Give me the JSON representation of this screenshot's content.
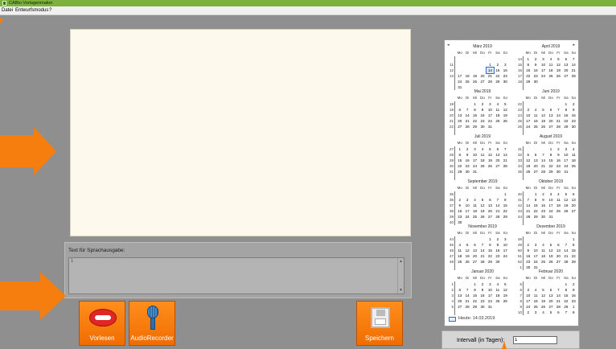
{
  "window": {
    "title": "CABto Vorlagenmaker"
  },
  "menu": [
    "Datei",
    "Entwurfsmodus",
    "?"
  ],
  "speech": {
    "label": "Text für Sprachausgabe:",
    "value": "1"
  },
  "buttons": {
    "speak": "Vorlesen",
    "recorder": "AudioRecorder",
    "save": "Speichern"
  },
  "calendar": {
    "nav_prev": "◂",
    "nav_next": "▸",
    "day_headers": [
      "Mo",
      "Di",
      "Mi",
      "Do",
      "Fr",
      "Sa",
      "So"
    ],
    "today_label": "Heute: 14.03.2019",
    "months": [
      {
        "title": "März 2019",
        "weeks": [
          "",
          "11",
          "12",
          "13",
          "",
          ""
        ],
        "days": [
          "",
          "",
          "",
          "",
          "",
          "",
          "",
          "",
          "",
          "",
          "",
          "1",
          "2",
          "3",
          "",
          "",
          "",
          "",
          "14",
          "15",
          "16",
          "17",
          "18",
          "19",
          "20",
          "21",
          "22",
          "23",
          "24",
          "25",
          "26",
          "27",
          "28",
          "29",
          "30",
          "31"
        ],
        "dim": [],
        "today": "14"
      },
      {
        "title": "April 2019",
        "weeks": [
          "14",
          "15",
          "16",
          "17",
          "18",
          ""
        ],
        "days": [
          "1",
          "2",
          "3",
          "4",
          "5",
          "6",
          "7",
          "8",
          "9",
          "10",
          "11",
          "12",
          "13",
          "14",
          "15",
          "16",
          "17",
          "18",
          "19",
          "20",
          "21",
          "22",
          "23",
          "24",
          "25",
          "26",
          "27",
          "28",
          "29",
          "30"
        ]
      },
      {
        "title": "Mai 2019",
        "weeks": [
          "18",
          "19",
          "20",
          "21",
          "22",
          ""
        ],
        "days": [
          "",
          "",
          "1",
          "2",
          "3",
          "4",
          "5",
          "6",
          "7",
          "8",
          "9",
          "10",
          "11",
          "12",
          "13",
          "14",
          "15",
          "16",
          "17",
          "18",
          "19",
          "20",
          "21",
          "22",
          "23",
          "24",
          "25",
          "26",
          "27",
          "28",
          "29",
          "30",
          "31"
        ]
      },
      {
        "title": "Juni 2019",
        "weeks": [
          "22",
          "23",
          "24",
          "25",
          "26",
          ""
        ],
        "days": [
          "",
          "",
          "",
          "",
          "",
          "1",
          "2",
          "3",
          "4",
          "5",
          "6",
          "7",
          "8",
          "9",
          "10",
          "11",
          "12",
          "13",
          "14",
          "15",
          "16",
          "17",
          "18",
          "19",
          "20",
          "21",
          "22",
          "23",
          "24",
          "25",
          "26",
          "27",
          "28",
          "29",
          "30"
        ]
      },
      {
        "title": "Juli 2019",
        "weeks": [
          "27",
          "28",
          "29",
          "30",
          "31",
          ""
        ],
        "days": [
          "1",
          "2",
          "3",
          "4",
          "5",
          "6",
          "7",
          "8",
          "9",
          "10",
          "11",
          "12",
          "13",
          "14",
          "15",
          "16",
          "17",
          "18",
          "19",
          "20",
          "21",
          "22",
          "23",
          "24",
          "25",
          "26",
          "27",
          "28",
          "29",
          "30",
          "31"
        ]
      },
      {
        "title": "August 2019",
        "weeks": [
          "31",
          "32",
          "33",
          "34",
          "35",
          ""
        ],
        "days": [
          "",
          "",
          "",
          "1",
          "2",
          "3",
          "4",
          "5",
          "6",
          "7",
          "8",
          "9",
          "10",
          "11",
          "12",
          "13",
          "14",
          "15",
          "16",
          "17",
          "18",
          "19",
          "20",
          "21",
          "22",
          "23",
          "24",
          "25",
          "26",
          "27",
          "28",
          "29",
          "30",
          "31"
        ]
      },
      {
        "title": "September 2019",
        "weeks": [
          "35",
          "36",
          "37",
          "38",
          "39",
          "40"
        ],
        "days": [
          "",
          "",
          "",
          "",
          "",
          "",
          "1",
          "2",
          "3",
          "4",
          "5",
          "6",
          "7",
          "8",
          "9",
          "10",
          "11",
          "12",
          "13",
          "14",
          "15",
          "16",
          "17",
          "18",
          "19",
          "20",
          "21",
          "22",
          "23",
          "24",
          "25",
          "26",
          "27",
          "28",
          "29",
          "30"
        ]
      },
      {
        "title": "Oktober 2019",
        "weeks": [
          "40",
          "41",
          "42",
          "43",
          "44",
          ""
        ],
        "days": [
          "",
          "1",
          "2",
          "3",
          "4",
          "5",
          "6",
          "7",
          "8",
          "9",
          "10",
          "11",
          "12",
          "13",
          "14",
          "15",
          "16",
          "17",
          "18",
          "19",
          "20",
          "21",
          "22",
          "23",
          "24",
          "25",
          "26",
          "27",
          "28",
          "29",
          "30",
          "31"
        ]
      },
      {
        "title": "November 2019",
        "weeks": [
          "44",
          "45",
          "46",
          "47",
          "48",
          ""
        ],
        "days": [
          "",
          "",
          "",
          "",
          "1",
          "2",
          "3",
          "4",
          "5",
          "6",
          "7",
          "8",
          "9",
          "10",
          "11",
          "12",
          "13",
          "14",
          "15",
          "16",
          "17",
          "18",
          "19",
          "20",
          "21",
          "22",
          "23",
          "24",
          "25",
          "26",
          "27",
          "28",
          "29",
          "30"
        ]
      },
      {
        "title": "Dezember 2019",
        "weeks": [
          "48",
          "49",
          "50",
          "51",
          "52",
          "1"
        ],
        "days": [
          "",
          "",
          "",
          "",
          "",
          "",
          "1",
          "2",
          "3",
          "4",
          "5",
          "6",
          "7",
          "8",
          "9",
          "10",
          "11",
          "12",
          "13",
          "14",
          "15",
          "16",
          "17",
          "18",
          "19",
          "20",
          "21",
          "22",
          "23",
          "24",
          "25",
          "26",
          "27",
          "28",
          "29",
          "30",
          "31"
        ]
      },
      {
        "title": "Januar 2020",
        "weeks": [
          "1",
          "2",
          "3",
          "4",
          "5",
          ""
        ],
        "days": [
          "",
          "",
          "1",
          "2",
          "3",
          "4",
          "5",
          "6",
          "7",
          "8",
          "9",
          "10",
          "11",
          "12",
          "13",
          "14",
          "15",
          "16",
          "17",
          "18",
          "19",
          "20",
          "21",
          "22",
          "23",
          "24",
          "25",
          "26",
          "27",
          "28",
          "29",
          "30",
          "31"
        ]
      },
      {
        "title": "Februar 2020",
        "weeks": [
          "5",
          "6",
          "7",
          "8",
          "9",
          "10"
        ],
        "days": [
          "",
          "",
          "",
          "",
          "",
          "1",
          "2",
          "3",
          "4",
          "5",
          "6",
          "7",
          "8",
          "9",
          "10",
          "11",
          "12",
          "13",
          "14",
          "15",
          "16",
          "17",
          "18",
          "19",
          "20",
          "21",
          "22",
          "23",
          "24",
          "25",
          "26",
          "27",
          "28",
          "29",
          "1",
          "2",
          "3",
          "4",
          "5",
          "6",
          "7",
          "8"
        ]
      }
    ]
  },
  "interval": {
    "label": "Intervall (in Tagen):",
    "value": "1"
  },
  "colors": {
    "accent": "#f57e0f",
    "titlebar": "#7bb13c",
    "canvas": "#fdf9ec"
  },
  "icons": {
    "lips": "lips-icon",
    "microphone": "microphone-icon",
    "floppy": "floppy-disk-icon"
  }
}
